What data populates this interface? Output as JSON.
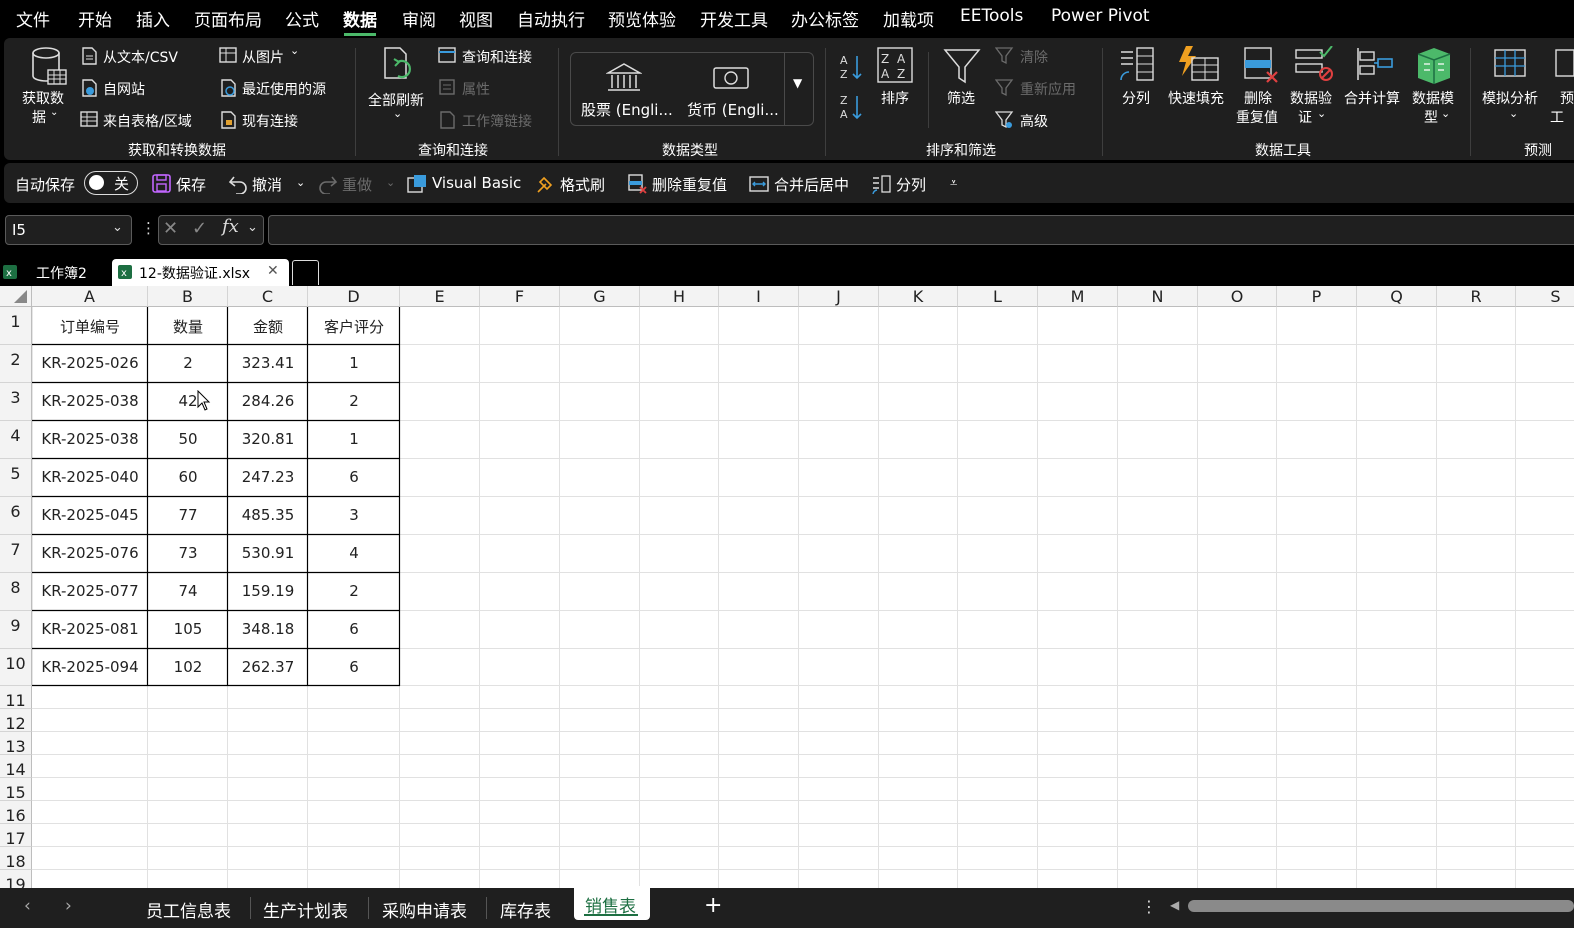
{
  "menu": [
    "文件",
    "开始",
    "插入",
    "页面布局",
    "公式",
    "数据",
    "审阅",
    "视图",
    "自动执行",
    "预览体验",
    "开发工具",
    "办公标签",
    "加载项",
    "EETools",
    "Power Pivot"
  ],
  "ribbon": {
    "get_data": {
      "btn": "获取数",
      "btn2": "据",
      "from_text": "从文本/CSV",
      "from_web": "自网站",
      "from_table": "来自表格/区域",
      "from_picture": "从图片",
      "recent": "最近使用的源",
      "existing": "现有连接",
      "group": "获取和转换数据"
    },
    "queries": {
      "refresh": "全部刷新",
      "queries_conn": "查询和连接",
      "properties": "属性",
      "wb_links": "工作簿链接",
      "group": "查询和连接"
    },
    "datatypes": {
      "stocks": "股票 (Engli...",
      "currency": "货币 (Engli...",
      "group": "数据类型"
    },
    "sort_filter": {
      "sort": "排序",
      "filter": "筛选",
      "clear": "清除",
      "reapply": "重新应用",
      "advanced": "高级",
      "group": "排序和筛选"
    },
    "tools": {
      "split": "分列",
      "flash": "快速填充",
      "remove_dup1": "删除",
      "remove_dup2": "重复值",
      "validate1": "数据验",
      "validate2": "证",
      "consolidate": "合并计算",
      "model1": "数据模",
      "model2": "型",
      "group": "数据工具"
    },
    "forecast": {
      "whatif": "模拟分析",
      "forecast_sheet1": "预",
      "forecast_sheet2": "工",
      "group": "预测"
    }
  },
  "qat": {
    "autosave": "自动保存",
    "toggle": "关",
    "save": "保存",
    "undo": "撤消",
    "redo": "重做",
    "vb": "Visual Basic",
    "format_painter": "格式刷",
    "remove_dup": "删除重复值",
    "merge": "合并后居中",
    "split": "分列"
  },
  "namebox": "I5",
  "workbook_tabs": [
    "工作簿2",
    "12-数据验证.xlsx"
  ],
  "columns": [
    "A",
    "B",
    "C",
    "D",
    "E",
    "F",
    "G",
    "H",
    "I",
    "J",
    "K",
    "L",
    "M",
    "N",
    "O",
    "P",
    "Q",
    "R",
    "S"
  ],
  "rows": [
    "1",
    "2",
    "3",
    "4",
    "5",
    "6",
    "7",
    "8",
    "9",
    "10",
    "11",
    "12",
    "13",
    "14",
    "15",
    "16",
    "17",
    "18",
    "19"
  ],
  "table": {
    "headers": [
      "订单编号",
      "数量",
      "金额",
      "客户评分"
    ],
    "data": [
      [
        "KR-2025-026",
        "2",
        "323.41",
        "1"
      ],
      [
        "KR-2025-038",
        "42",
        "284.26",
        "2"
      ],
      [
        "KR-2025-038",
        "50",
        "320.81",
        "1"
      ],
      [
        "KR-2025-040",
        "60",
        "247.23",
        "6"
      ],
      [
        "KR-2025-045",
        "77",
        "485.35",
        "3"
      ],
      [
        "KR-2025-076",
        "73",
        "530.91",
        "4"
      ],
      [
        "KR-2025-077",
        "74",
        "159.19",
        "2"
      ],
      [
        "KR-2025-081",
        "105",
        "348.18",
        "6"
      ],
      [
        "KR-2025-094",
        "102",
        "262.37",
        "6"
      ]
    ]
  },
  "sheets": [
    "员工信息表",
    "生产计划表",
    "采购申请表",
    "库存表",
    "销售表"
  ],
  "active_sheet": "销售表",
  "colors": {
    "accent": "#4cb96a",
    "excel_green": "#1d6f42",
    "blue_icon": "#3a9bdc"
  }
}
